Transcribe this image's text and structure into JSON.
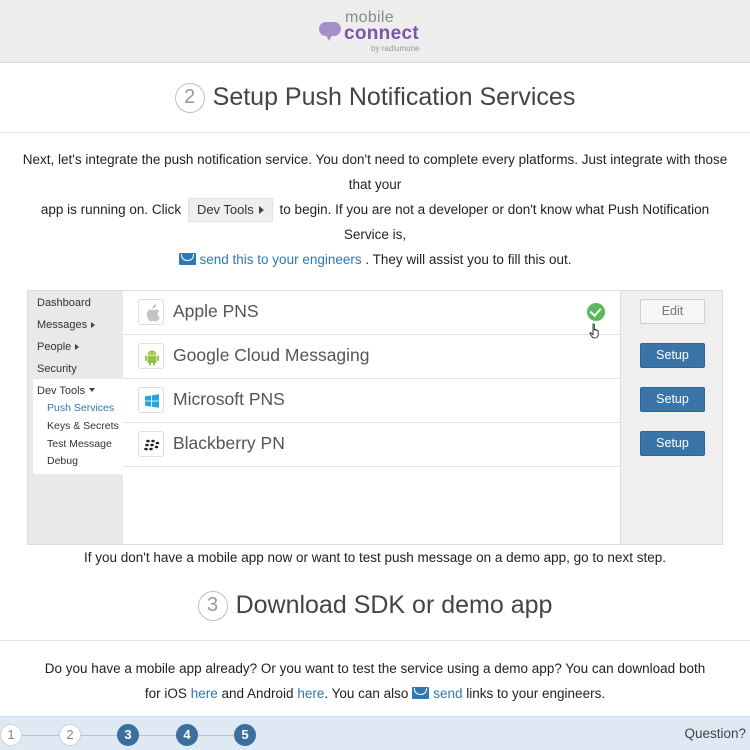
{
  "header": {
    "logo_word1": "mobile",
    "logo_word2": "connect",
    "logo_by": "by radiumone",
    "brand_color": "#7b56a8"
  },
  "step2": {
    "number": "2",
    "title": "Setup Push Notification Services",
    "intro_line1": "Next, let's integrate the push notification service. You don't need to complete every platforms. Just integrate with those that your",
    "intro_line2_prefix": "app is running on. Click",
    "dev_tools_chip": "Dev Tools",
    "intro_line2_suffix": "to begin. If you are not a developer or don't know what Push Notification Service is,",
    "send_link": "send this to your engineers",
    "send_suffix": ". They will assist you to fill this out."
  },
  "sidebar": {
    "items": [
      "Dashboard",
      "Messages",
      "People",
      "Security",
      "Dev Tools"
    ],
    "sub_items": [
      "Push Services",
      "Keys & Secrets",
      "Test Message",
      "Debug"
    ],
    "active_sub": "Push Services"
  },
  "services": [
    {
      "name": "Apple PNS",
      "icon": "apple-icon",
      "action": "Edit",
      "configured": true
    },
    {
      "name": "Google Cloud Messaging",
      "icon": "android-icon",
      "action": "Setup",
      "configured": false
    },
    {
      "name": "Microsoft PNS",
      "icon": "windows-icon",
      "action": "Setup",
      "configured": false
    },
    {
      "name": "Blackberry PN",
      "icon": "blackberry-icon",
      "action": "Setup",
      "configured": false
    }
  ],
  "note_after_panel": "If you don't have a mobile app now or want to test push message on a demo app, go to next step.",
  "step3": {
    "number": "3",
    "title": "Download SDK or demo app",
    "line1": "Do you have a mobile app already? Or you want to test the service using a demo app? You can download both",
    "line2_prefix": "for iOS",
    "here_ios": "here",
    "line2_mid": "and Android",
    "here_android": "here",
    "line2_also": ". You can also",
    "send_word": "send",
    "line2_suffix": "links to your engineers."
  },
  "progress": {
    "steps": [
      "1",
      "2",
      "3",
      "4",
      "5"
    ],
    "completed": 2,
    "question": "Question?"
  },
  "colors": {
    "link": "#2f78b4",
    "button": "#3b74a8",
    "success": "#5cb85c"
  }
}
